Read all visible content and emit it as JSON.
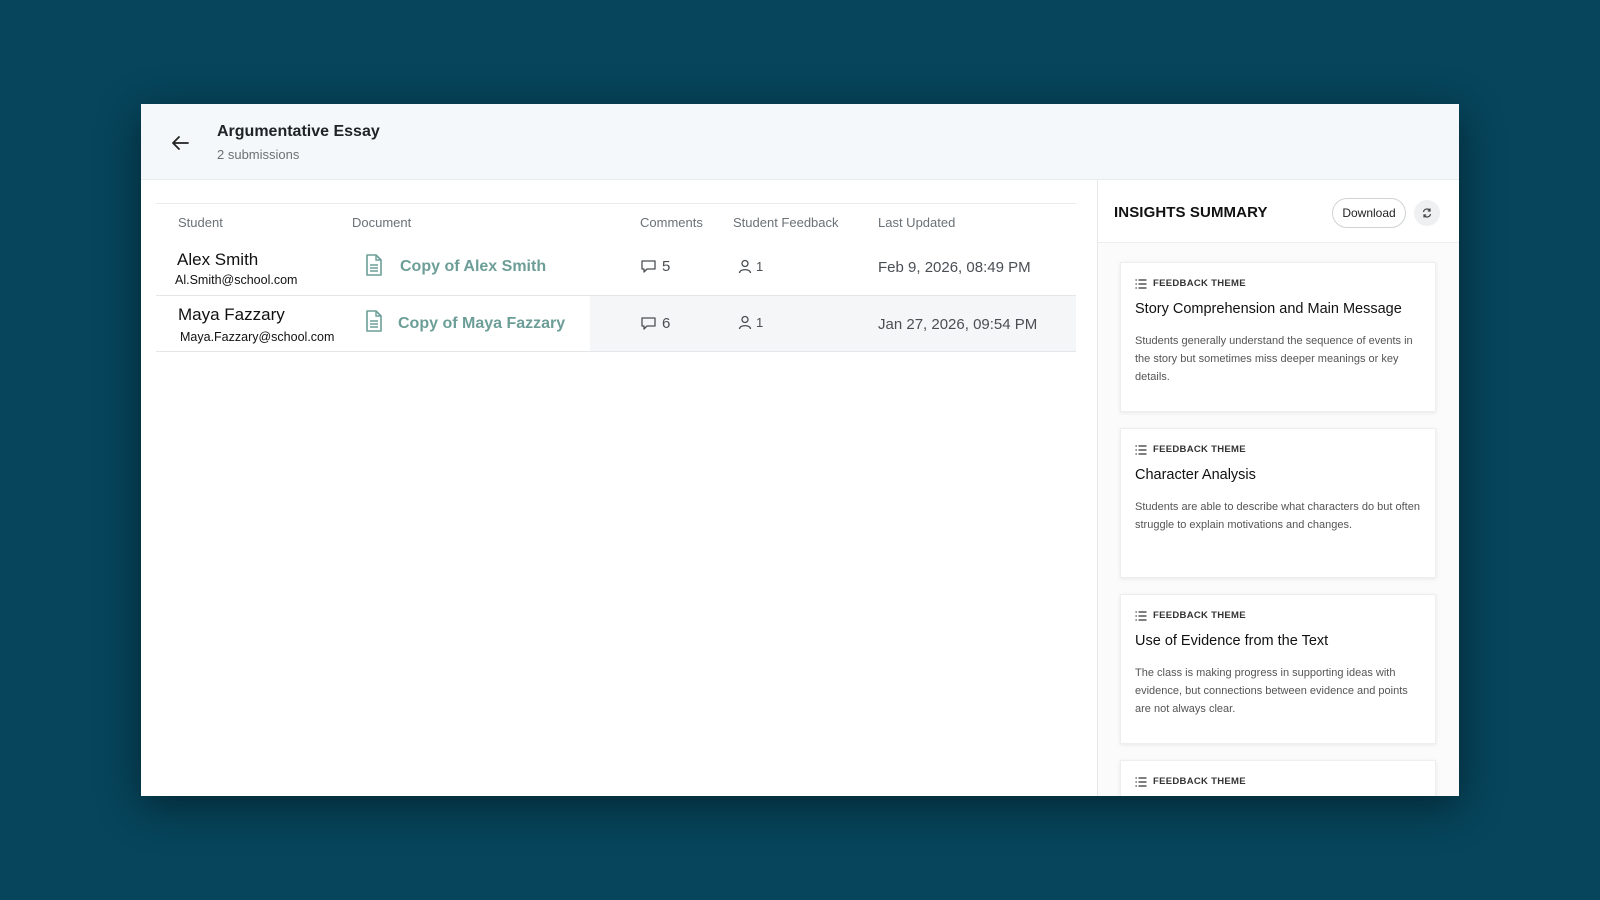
{
  "header": {
    "title": "Argumentative Essay",
    "subtitle": "2 submissions"
  },
  "table": {
    "columns": [
      "Student",
      "Document",
      "Comments",
      "Student Feedback",
      "Last Updated"
    ],
    "rows": [
      {
        "name": "Alex Smith",
        "email": "Al.Smith@school.com",
        "document": "Copy of Alex Smith",
        "comments": "5",
        "feedback": "1",
        "updated": "Feb 9, 2026, 08:49 PM"
      },
      {
        "name": "Maya Fazzary",
        "email": "Maya.Fazzary@school.com",
        "document": "Copy of Maya Fazzary",
        "comments": "6",
        "feedback": "1",
        "updated": "Jan 27, 2026, 09:54 PM"
      }
    ]
  },
  "insights": {
    "title": "INSIGHTS SUMMARY",
    "download_label": "Download",
    "cards": [
      {
        "kicker": "FEEDBACK THEME",
        "title": "Story Comprehension and Main Message",
        "body": "Students generally understand the sequence of events in the story but sometimes miss deeper meanings or key details."
      },
      {
        "kicker": "FEEDBACK THEME",
        "title": "Character Analysis",
        "body": "Students are able to describe what characters do but often struggle to explain motivations and changes."
      },
      {
        "kicker": "FEEDBACK THEME",
        "title": "Use of Evidence from the Text",
        "body": "The class is making progress in supporting ideas with evidence, but connections between evidence and points are not always clear."
      },
      {
        "kicker": "FEEDBACK THEME"
      }
    ]
  },
  "colors": {
    "background": "#06455c",
    "header_bg": "#f4f8fa",
    "link": "#6c9e97"
  },
  "icons": [
    "back-arrow-icon",
    "document-icon",
    "comment-icon",
    "person-icon",
    "list-icon",
    "refresh-icon"
  ]
}
